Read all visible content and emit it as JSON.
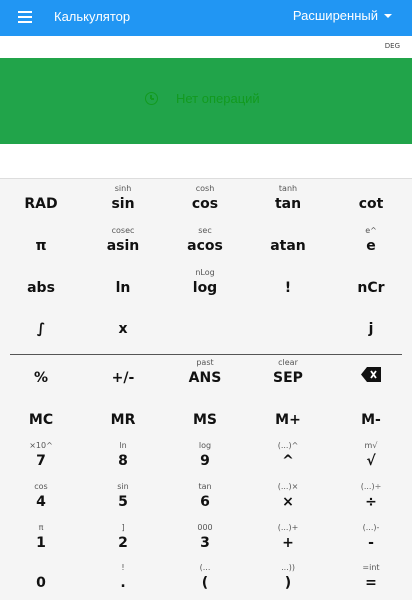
{
  "appbar": {
    "title": "Калькулятор",
    "mode": "Расширенный"
  },
  "angle_unit": "DEG",
  "banner": {
    "text": "Нет операций"
  },
  "rows": [
    [
      {
        "sub": "",
        "main": "RAD"
      },
      {
        "sub": "sinh",
        "main": "sin"
      },
      {
        "sub": "cosh",
        "main": "cos"
      },
      {
        "sub": "tanh",
        "main": "tan"
      },
      {
        "sub": "",
        "main": "cot"
      }
    ],
    [
      {
        "sub": "",
        "main": "π"
      },
      {
        "sub": "cosec",
        "main": "asin"
      },
      {
        "sub": "sec",
        "main": "acos"
      },
      {
        "sub": "",
        "main": "atan"
      },
      {
        "sub": "e^",
        "main": "e"
      }
    ],
    [
      {
        "sub": "",
        "main": "abs"
      },
      {
        "sub": "",
        "main": "ln"
      },
      {
        "sub": "nLog",
        "main": "log"
      },
      {
        "sub": "",
        "main": "!"
      },
      {
        "sub": "",
        "main": "nCr"
      }
    ],
    [
      {
        "sub": "",
        "main": "∫"
      },
      {
        "sub": "",
        "main": "x"
      },
      {
        "sub": "",
        "main": ""
      },
      {
        "sub": "",
        "main": ""
      },
      {
        "sub": "",
        "main": "j"
      }
    ],
    [
      {
        "sub": "",
        "main": "%"
      },
      {
        "sub": "",
        "main": "+/-"
      },
      {
        "sub": "past",
        "main": "ANS"
      },
      {
        "sub": "clear",
        "main": "SEP"
      },
      {
        "sub": "",
        "main": ""
      }
    ],
    [
      {
        "sub": "",
        "main": "MC"
      },
      {
        "sub": "",
        "main": "MR"
      },
      {
        "sub": "",
        "main": "MS"
      },
      {
        "sub": "",
        "main": "M+"
      },
      {
        "sub": "",
        "main": "M-"
      }
    ],
    [
      {
        "sub": "×10^",
        "main": "7"
      },
      {
        "sub": "ln",
        "main": "8"
      },
      {
        "sub": "log",
        "main": "9"
      },
      {
        "sub": "(...)^",
        "main": "^"
      },
      {
        "sub": "m√",
        "main": "√"
      }
    ],
    [
      {
        "sub": "cos",
        "main": "4"
      },
      {
        "sub": "sin",
        "main": "5"
      },
      {
        "sub": "tan",
        "main": "6"
      },
      {
        "sub": "(...)×",
        "main": "×"
      },
      {
        "sub": "(...)÷",
        "main": "÷"
      }
    ],
    [
      {
        "sub": "π",
        "main": "1"
      },
      {
        "sub": "]",
        "main": "2"
      },
      {
        "sub": "000",
        "main": "3"
      },
      {
        "sub": "(...)+",
        "main": "+"
      },
      {
        "sub": "(...)-",
        "main": "-"
      }
    ],
    [
      {
        "sub": "",
        "main": "0"
      },
      {
        "sub": "!",
        "main": "."
      },
      {
        "sub": "(...",
        "main": "("
      },
      {
        "sub": "...))",
        "main": ")"
      },
      {
        "sub": "=int",
        "main": "="
      }
    ]
  ],
  "icons": {
    "menu": "menu-icon",
    "history": "history-icon",
    "backspace": "backspace-icon"
  },
  "colors": {
    "appbar": "#2196f3",
    "banner": "#21a44a",
    "banner_text": "#129a1f"
  }
}
